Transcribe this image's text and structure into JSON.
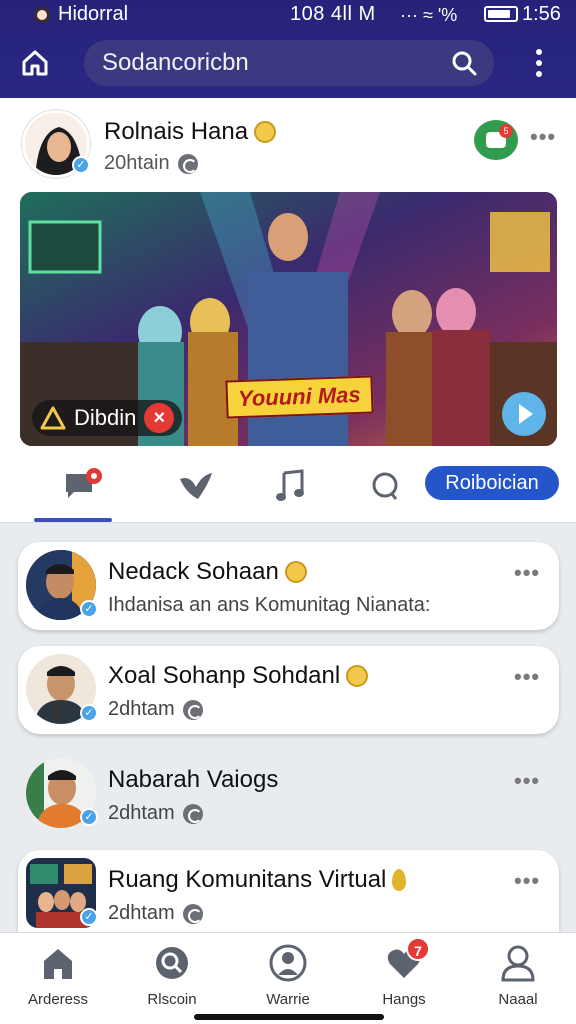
{
  "status_bar": {
    "app_name": "Hidorral",
    "network_text": "108 4ll M",
    "signal_text": "··· ≈ '%",
    "time": "1:56"
  },
  "header": {
    "search_text": "Sodancoricbn",
    "icons": [
      "home-icon",
      "search-icon",
      "more-vertical-icon"
    ]
  },
  "feature_post": {
    "author": "Rolnais Hana",
    "time": "20htain",
    "chat_badge_count": "5",
    "media": {
      "tag_label": "Dibdin",
      "title": "Youuni Mas"
    },
    "tabs": [
      "chat-tab",
      "heart-tab",
      "music-tab",
      "search-tab"
    ],
    "pill_label": "Roiboician"
  },
  "list": [
    {
      "name": "Nedack Sohaan",
      "subtitle": "Ihdanisa an ans Komunitag Nianata:",
      "badge_icon": "smiley-crown-icon",
      "card": true
    },
    {
      "name": "Xoal Sohanp Sohdanl",
      "subtitle": "2dhtam",
      "badge_icon": "smiley-crown-icon",
      "card": true
    },
    {
      "name": "Nabarah Vaiogs",
      "subtitle": "2dhtam",
      "badge_icon": "",
      "card": false
    },
    {
      "name": "Ruang Komunitans Virtual",
      "subtitle": "2dhtam",
      "badge_icon": "drop-icon",
      "card": true
    }
  ],
  "bottom_nav": [
    {
      "label": "Arderess",
      "icon": "house-icon"
    },
    {
      "label": "Rlscoin",
      "icon": "search-icon"
    },
    {
      "label": "Warrie",
      "icon": "profile-circle-icon"
    },
    {
      "label": "Hangs",
      "icon": "heart-icon",
      "badge": "7"
    },
    {
      "label": "Naaal",
      "icon": "user-icon"
    }
  ],
  "colors": {
    "header_bg": "#27237a",
    "accent_blue": "#2556c9",
    "badge_red": "#e53935",
    "chat_green": "#2f9d4d"
  }
}
